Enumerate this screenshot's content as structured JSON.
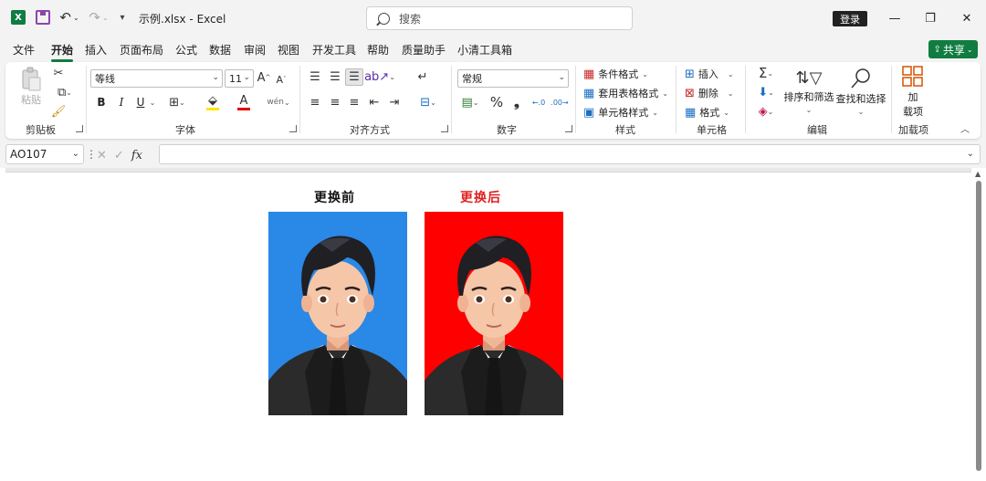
{
  "window": {
    "title": "示例.xlsx  -  Excel",
    "search_placeholder": "搜索",
    "login_label": "登录",
    "minimize": "—",
    "restore": "❐",
    "close": "✕"
  },
  "menu": {
    "tabs": [
      {
        "label": "文件"
      },
      {
        "label": "开始",
        "active": true
      },
      {
        "label": "插入"
      },
      {
        "label": "页面布局"
      },
      {
        "label": "公式"
      },
      {
        "label": "数据"
      },
      {
        "label": "审阅"
      },
      {
        "label": "视图"
      },
      {
        "label": "开发工具"
      },
      {
        "label": "帮助"
      },
      {
        "label": "质量助手"
      },
      {
        "label": "小清工具箱"
      }
    ],
    "share_label": "共享"
  },
  "ribbon": {
    "clipboard": {
      "paste": "粘贴",
      "group": "剪贴板"
    },
    "font": {
      "name": "等线",
      "size": "11",
      "bold": "B",
      "italic": "I",
      "underline": "U",
      "group": "字体"
    },
    "alignment": {
      "group": "对齐方式"
    },
    "number": {
      "format": "常规",
      "group": "数字"
    },
    "styles": {
      "conditional": "条件格式",
      "table": "套用表格格式",
      "cell": "单元格样式",
      "group": "样式"
    },
    "cells": {
      "insert": "插入",
      "delete": "删除",
      "format": "格式",
      "group": "单元格"
    },
    "editing": {
      "sort": "排序和筛选",
      "find": "查找和选择",
      "group": "编辑"
    },
    "addins": {
      "label_line1": "加",
      "label_line2": "载项",
      "group": "加载项"
    }
  },
  "formula_bar": {
    "name_box": "AO107",
    "formula": ""
  },
  "sheet": {
    "before_title": "更换前",
    "after_title": "更换后",
    "before_bg": "#2a88e6",
    "after_bg": "#ff0000",
    "after_title_color": "#e02020"
  },
  "colors": {
    "accent": "#107c41"
  }
}
